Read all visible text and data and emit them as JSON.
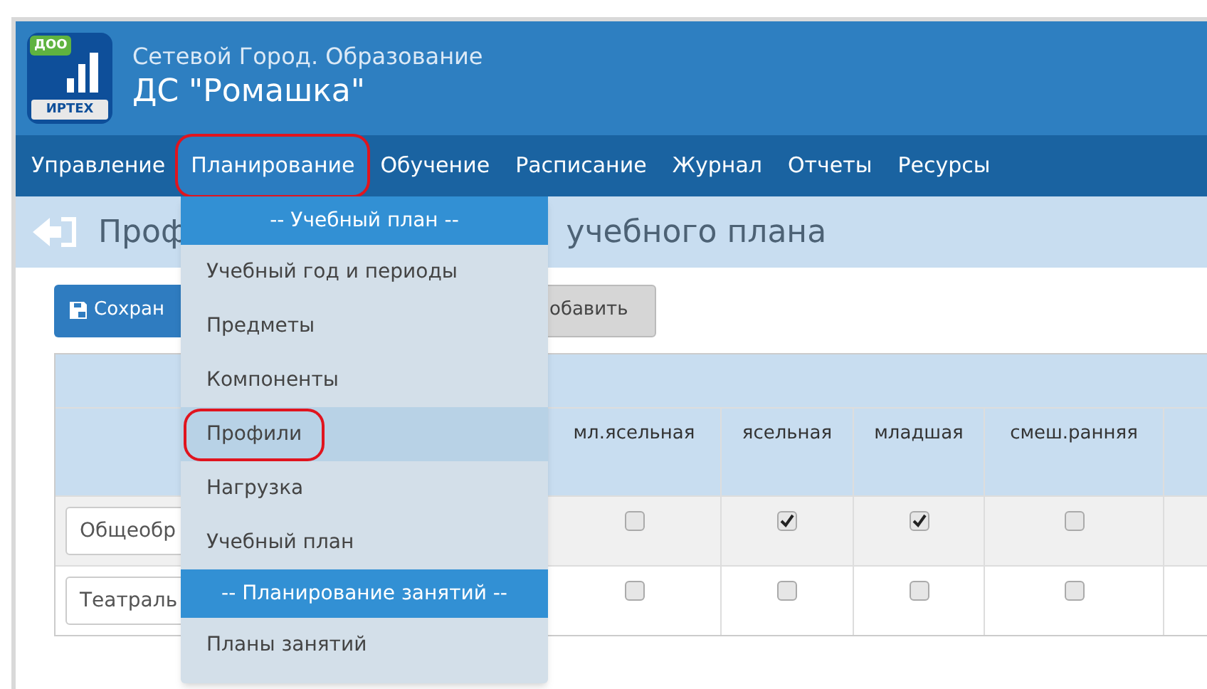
{
  "logo": {
    "badge": "ДОО",
    "label": "ИРТЕХ"
  },
  "header": {
    "subtitle": "Сетевой Город. Образование",
    "title": "ДС \"Ромашка\""
  },
  "nav": [
    {
      "label": "Управление",
      "selected": false
    },
    {
      "label": "Планирование",
      "selected": true
    },
    {
      "label": "Обучение",
      "selected": false
    },
    {
      "label": "Расписание",
      "selected": false
    },
    {
      "label": "Журнал",
      "selected": false
    },
    {
      "label": "Отчеты",
      "selected": false
    },
    {
      "label": "Ресурсы",
      "selected": false
    }
  ],
  "page_title": {
    "left_part": "Проф",
    "right_part": "учебного плана"
  },
  "buttons": [
    {
      "label": "Сохран",
      "kind": "primary"
    },
    {
      "label": "обавить",
      "kind": "secondary"
    }
  ],
  "table": {
    "columns": [
      "мл.ясельная",
      "ясельная",
      "младшая",
      "смеш.ранняя"
    ],
    "rows": [
      {
        "name": "Общеобр",
        "checked": [
          false,
          true,
          true,
          false
        ]
      },
      {
        "name": "Театраль",
        "checked": [
          false,
          false,
          false,
          false
        ]
      }
    ]
  },
  "menu": [
    {
      "kind": "header",
      "label": "-- Учебный план --"
    },
    {
      "kind": "item",
      "label": "Учебный год и периоды",
      "selected": false
    },
    {
      "kind": "item",
      "label": "Предметы",
      "selected": false
    },
    {
      "kind": "item",
      "label": "Компоненты",
      "selected": false
    },
    {
      "kind": "item",
      "label": "Профили",
      "selected": true
    },
    {
      "kind": "item",
      "label": "Нагрузка",
      "selected": false
    },
    {
      "kind": "item",
      "label": "Учебный план",
      "selected": false
    },
    {
      "kind": "header",
      "label": "-- Планирование занятий --"
    },
    {
      "kind": "item",
      "label": "Планы занятий",
      "selected": false
    }
  ]
}
